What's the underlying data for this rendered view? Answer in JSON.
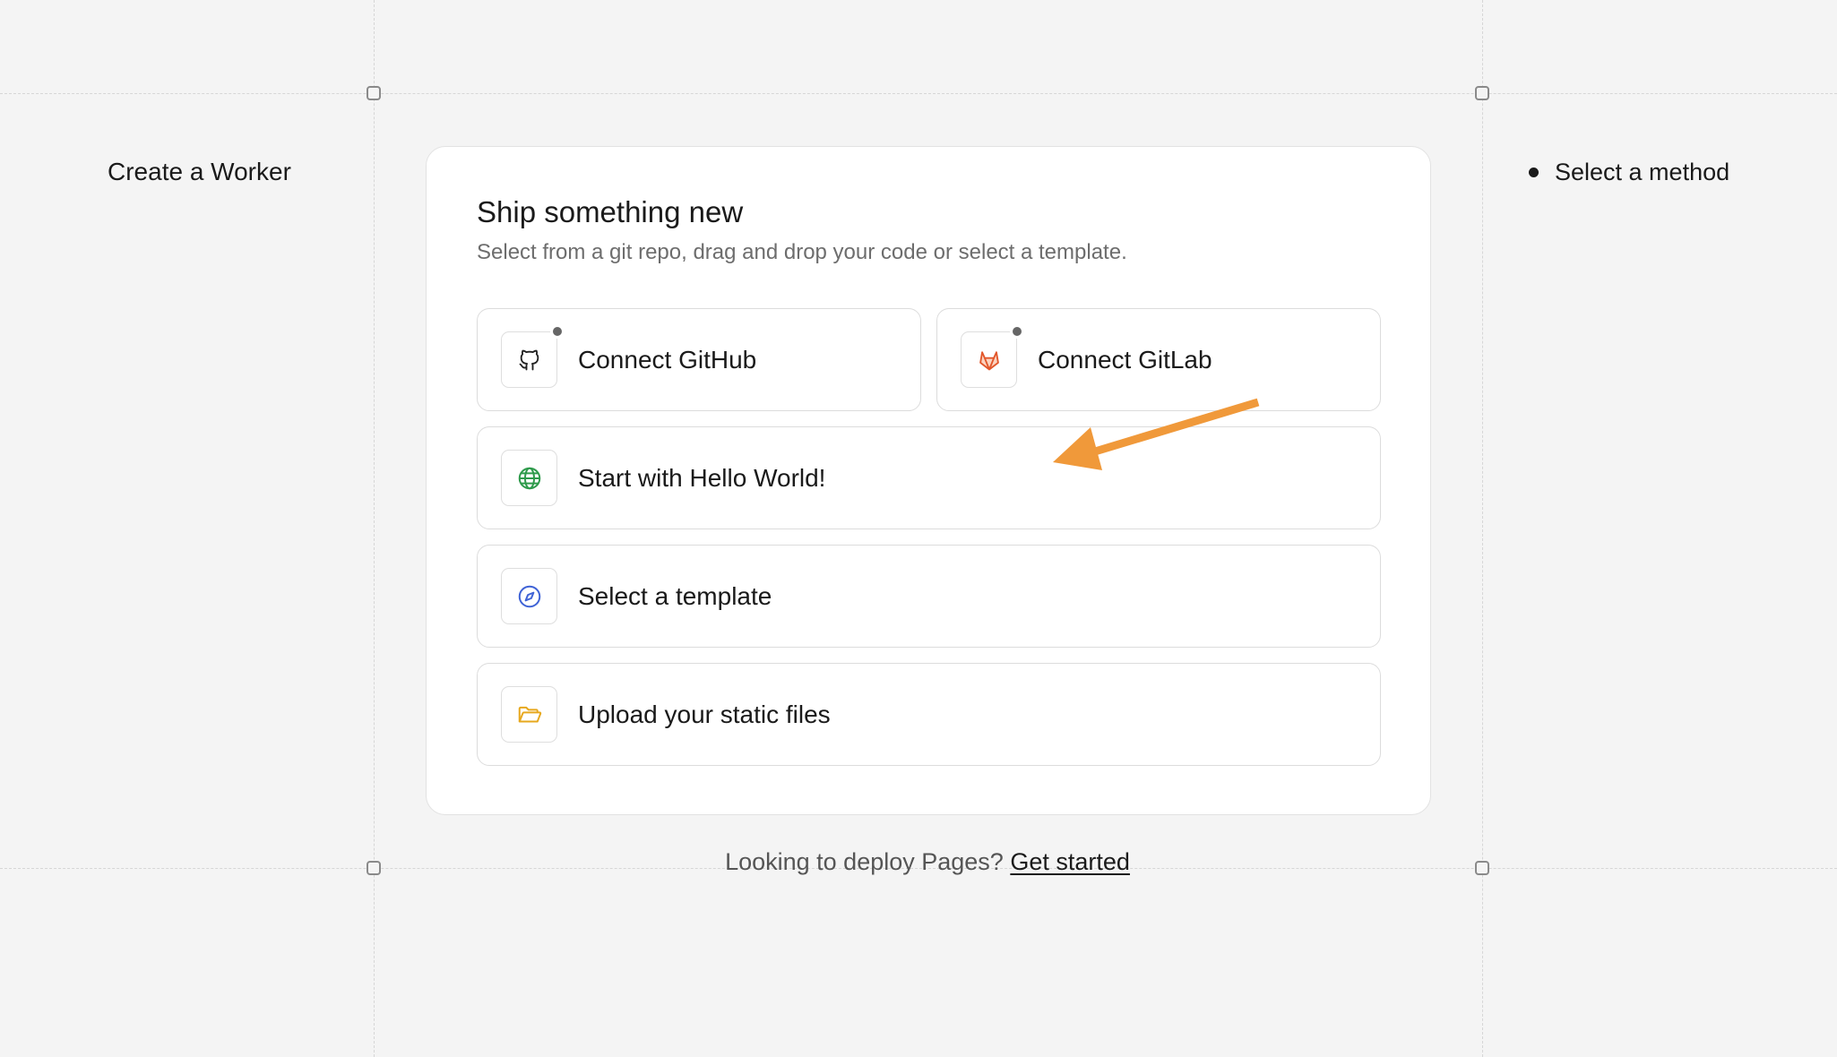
{
  "page": {
    "title": "Create a Worker",
    "step_label": "Select a method"
  },
  "card": {
    "title": "Ship something new",
    "subtitle": "Select from a git repo, drag and drop your code or select a template."
  },
  "options": {
    "github": {
      "label": "Connect GitHub",
      "icon": "github-icon"
    },
    "gitlab": {
      "label": "Connect GitLab",
      "icon": "gitlab-icon"
    },
    "hello_world": {
      "label": "Start with Hello World!",
      "icon": "globe-icon"
    },
    "template": {
      "label": "Select a template",
      "icon": "compass-icon"
    },
    "upload": {
      "label": "Upload your static files",
      "icon": "folder-open-icon"
    }
  },
  "footer": {
    "text": "Looking to deploy Pages?",
    "link_label": "Get started"
  },
  "colors": {
    "annotation_arrow": "#f0993a",
    "globe": "#2e9a4b",
    "compass": "#3f63d6",
    "folder": "#e7a81e",
    "gitlab": "#e2572b"
  }
}
